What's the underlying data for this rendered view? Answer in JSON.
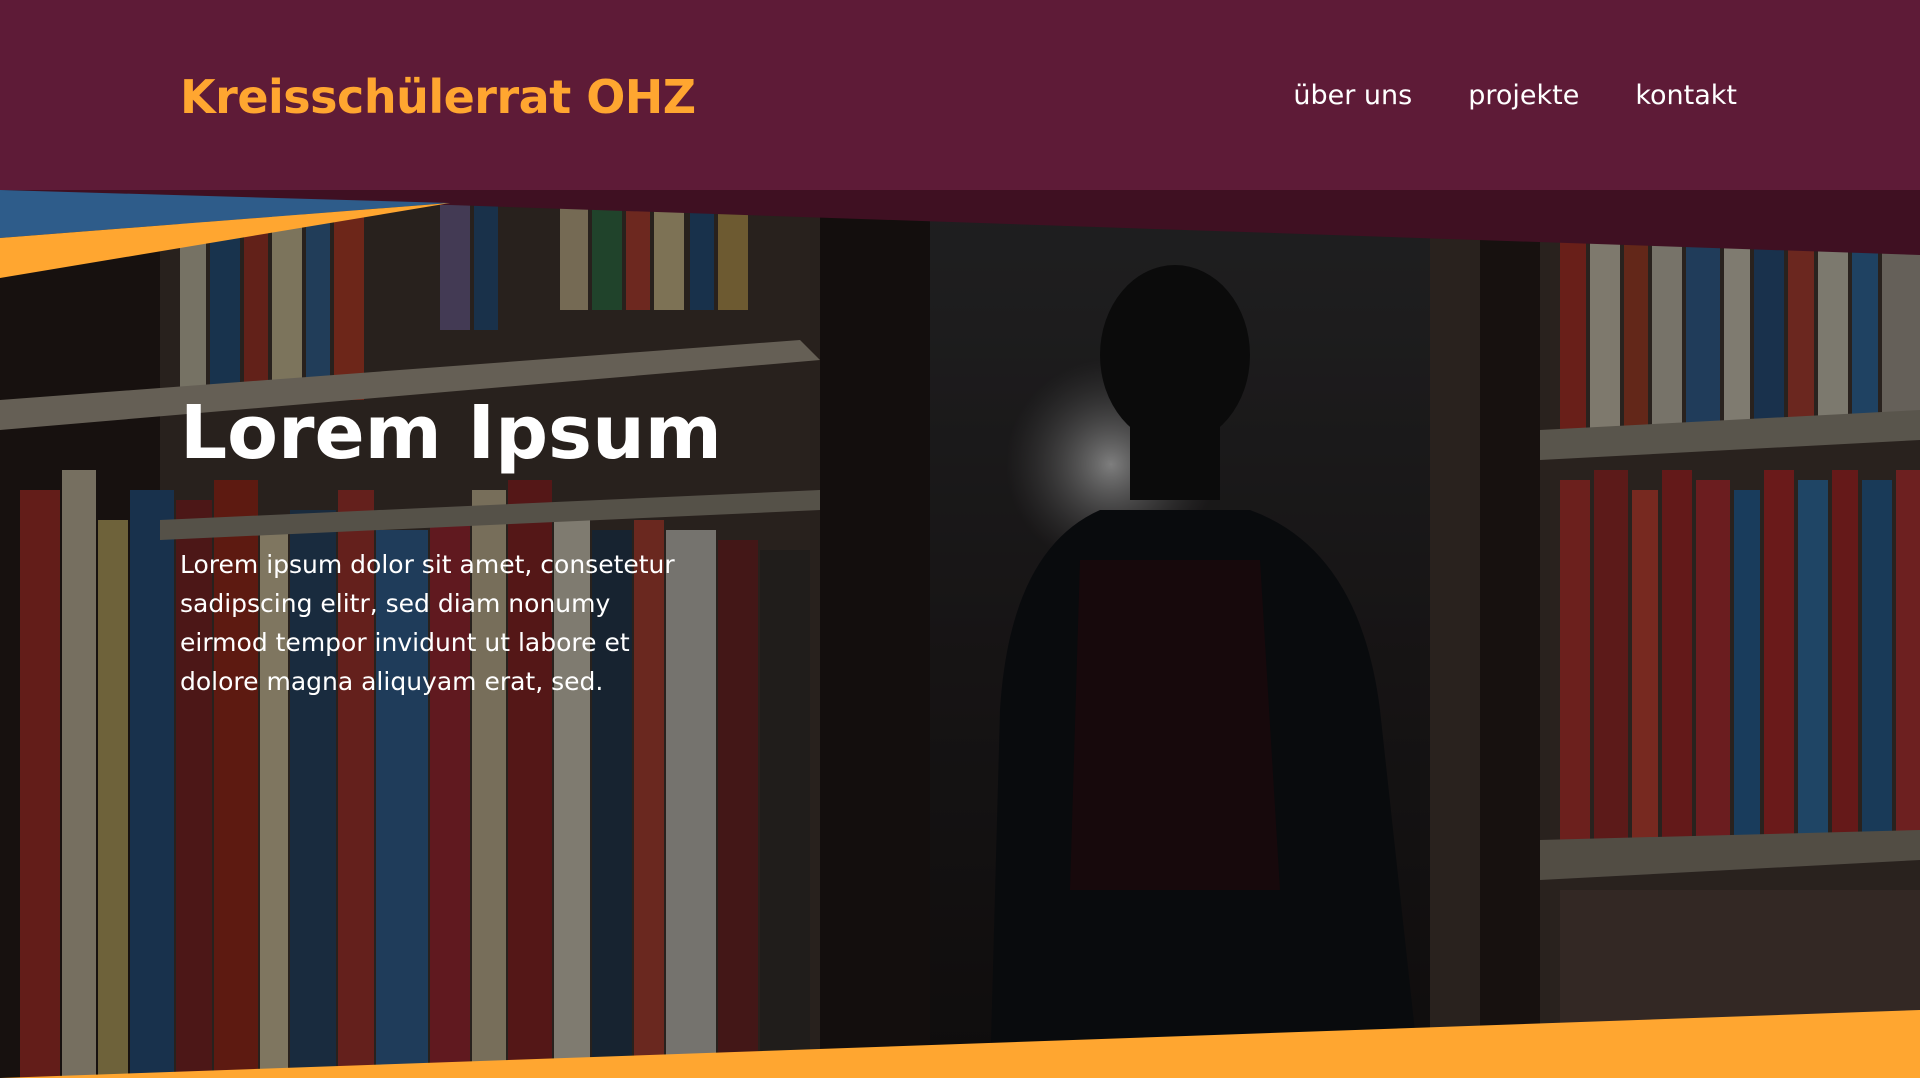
{
  "header": {
    "brand": "Kreisschülerrat OHZ",
    "nav": [
      {
        "label": "über uns"
      },
      {
        "label": "projekte"
      },
      {
        "label": "kontakt"
      }
    ]
  },
  "hero": {
    "title": "Lorem Ipsum",
    "text": "Lorem ipsum dolor sit amet, consetetur sadipscing elitr, sed diam nonumy eirmod tempor invidunt ut labore et dolore magna aliquyam erat, sed."
  },
  "colors": {
    "header_bg": "#5e1b37",
    "header_shadow": "#3f1022",
    "accent_orange": "#ffa630",
    "accent_blue": "#2e5c8a",
    "text": "#ffffff"
  }
}
